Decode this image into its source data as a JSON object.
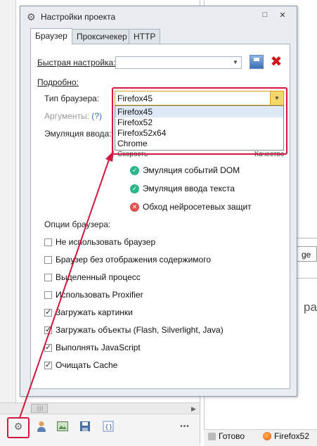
{
  "dialog": {
    "title": "Настройки проекта",
    "tabs": [
      {
        "label": "Браузер",
        "active": true
      },
      {
        "label": "Проксичекер",
        "active": false
      },
      {
        "label": "HTTP",
        "active": false
      }
    ],
    "quick_setup_label": "Быстрая настройка:",
    "quick_setup_value": "",
    "details_label": "Подробно:",
    "browser_type_label": "Тип браузера:",
    "browser_type_value": "Firefox45",
    "browser_options": [
      "Firefox45",
      "Firefox52",
      "Firefox52x64",
      "Chrome"
    ],
    "args_label": "Аргументы:",
    "args_help": "(?)",
    "input_emulation_label": "Эмуляция ввода:",
    "speed_label": "Скорость",
    "quality_label": "Качество",
    "features": [
      {
        "label": "Эмуляция событий DOM",
        "status": "ok"
      },
      {
        "label": "Эмуляция ввода текста",
        "status": "ok"
      },
      {
        "label": "Обход нейросетевых защит",
        "status": "bad"
      }
    ],
    "browser_options_label": "Опции браузера:",
    "checkboxes": [
      {
        "label": "Не использовать браузер",
        "checked": false
      },
      {
        "label": "Браузер без отображения содержимого",
        "checked": false
      },
      {
        "label": "Выделенный процесс",
        "checked": false
      },
      {
        "label": "Использовать Proxifier",
        "checked": false
      },
      {
        "label": "Загружать картинки",
        "checked": true
      },
      {
        "label": "Загружать объекты (Flash, Silverlight, Java)",
        "checked": true
      },
      {
        "label": "Выполнять JavaScript",
        "checked": true
      },
      {
        "label": "Очищать Cache",
        "checked": true
      }
    ],
    "window_buttons": [
      "□",
      "✕"
    ]
  },
  "background": {
    "field_text": "ge",
    "text_fragment": "ра",
    "status_ready": "Готово",
    "status_browser": "Firefox52"
  },
  "toolbar": {
    "icons": [
      "gear-icon",
      "user-icon",
      "image-icon",
      "save-icon",
      "code-icon"
    ],
    "more": "•••"
  },
  "colors": {
    "highlight": "#d5163f",
    "ok": "#2ab68a",
    "bad": "#e2504c"
  }
}
